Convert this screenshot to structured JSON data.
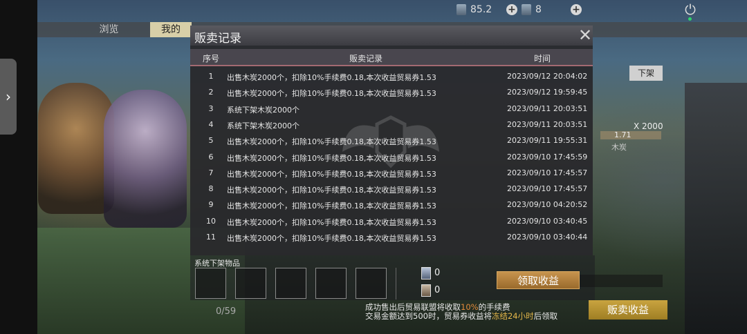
{
  "hud": {
    "currency1_value": "85.2",
    "currency2_value": "8",
    "currency1_icon": "trade-ticket-icon",
    "currency2_icon": "blue-card-icon"
  },
  "background": {
    "tab_browse": "浏览",
    "tab_mine": "我的",
    "delist_button": "下架",
    "item_quantity": "X 2000",
    "item_price": "1.71",
    "item_name": "木炭",
    "slot_count": "0/59"
  },
  "dialog": {
    "title": "贩卖记录",
    "columns": {
      "no": "序号",
      "record": "贩卖记录",
      "time": "时间"
    },
    "rows": [
      {
        "no": "1",
        "record": "出售木炭2000个，扣除10%手续费0.18,本次收益贸易券1.53",
        "time": "2023/09/12 20:04:02"
      },
      {
        "no": "2",
        "record": "出售木炭2000个，扣除10%手续费0.18,本次收益贸易券1.53",
        "time": "2023/09/12 19:59:45"
      },
      {
        "no": "3",
        "record": "系统下架木炭2000个",
        "time": "2023/09/11 20:03:51"
      },
      {
        "no": "4",
        "record": "系统下架木炭2000个",
        "time": "2023/09/11 20:03:51"
      },
      {
        "no": "5",
        "record": "出售木炭2000个，扣除10%手续费0.18,本次收益贸易券1.53",
        "time": "2023/09/11 19:55:31"
      },
      {
        "no": "6",
        "record": "出售木炭2000个，扣除10%手续费0.18,本次收益贸易券1.53",
        "time": "2023/09/10 17:45:59"
      },
      {
        "no": "7",
        "record": "出售木炭2000个，扣除10%手续费0.18,本次收益贸易券1.53",
        "time": "2023/09/10 17:45:57"
      },
      {
        "no": "8",
        "record": "出售木炭2000个，扣除10%手续费0.18,本次收益贸易券1.53",
        "time": "2023/09/10 17:45:57"
      },
      {
        "no": "9",
        "record": "出售木炭2000个，扣除10%手续费0.18,本次收益贸易券1.53",
        "time": "2023/09/10 04:20:52"
      },
      {
        "no": "10",
        "record": "出售木炭2000个，扣除10%手续费0.18,本次收益贸易券1.53",
        "time": "2023/09/10 03:40:45"
      },
      {
        "no": "11",
        "record": "出售木炭2000个，扣除10%手续费0.18,本次收益贸易券1.53",
        "time": "2023/09/10 03:40:44"
      }
    ]
  },
  "bottom": {
    "delisted_label": "系统下架物品",
    "ticket1_value": "0",
    "ticket2_value": "0",
    "claim_button": "领取收益",
    "sale_income_button": "贩卖收益",
    "info_line1_pre": "成功售出后贸易联盟将收取",
    "info_line1_highlight": "10%",
    "info_line1_post": "的手续费",
    "info_line2_pre": "交易金额达到500时，贸易券收益将",
    "info_line2_highlight": "冻结24小时",
    "info_line2_post": "后领取"
  },
  "colors": {
    "accent_orange": "#e28b3b",
    "accent_yellow": "#e6b84a",
    "button_gold": "#c7944e"
  }
}
